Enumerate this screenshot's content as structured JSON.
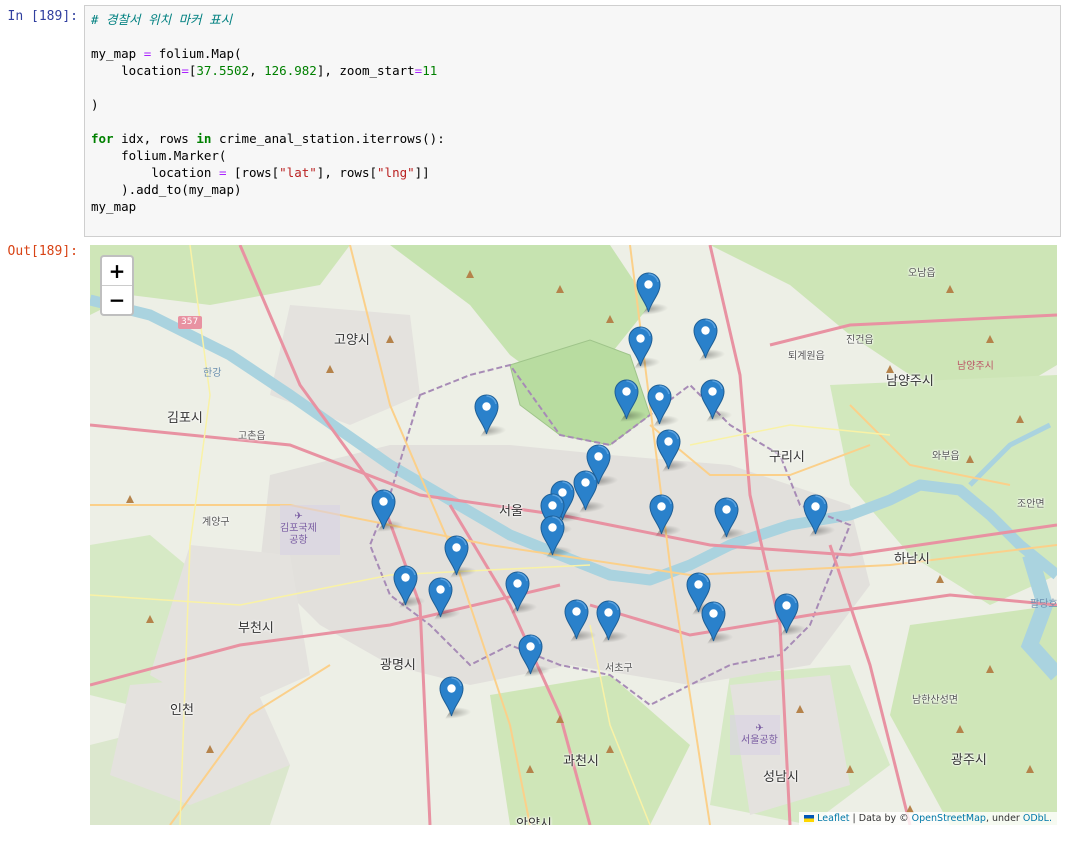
{
  "cell": {
    "in_prompt": "In [189]:",
    "out_prompt": "Out[189]:",
    "code_lines": [
      "# 경찰서 위치 마커 표시",
      "",
      "my_map = folium.Map(",
      "    location=[37.5502, 126.982], zoom_start=11",
      "",
      ")",
      "",
      "for idx, rows in crime_anal_station.iterrows():",
      "    folium.Marker(",
      "        location = [rows[\"lat\"], rows[\"lng\"]]",
      "    ).add_to(my_map)",
      "my_map"
    ]
  },
  "map": {
    "zoom_in": "+",
    "zoom_out": "−",
    "attribution": {
      "leaflet": "Leaflet",
      "sep": " | Data by © ",
      "osm": "OpenStreetMap",
      "under": ", under ",
      "odbl": "ODbL."
    },
    "labels": {
      "goyang": "고양시",
      "gimpo": "김포시",
      "bucheon": "부천시",
      "gwangmyeong": "광명시",
      "incheon": "인천",
      "seoul": "서울",
      "guri": "구리시",
      "hanam": "하남시",
      "namyangju": "남양주시",
      "gwacheon": "과천시",
      "seongnam": "성남시",
      "gwangju": "광주시",
      "anyang": "안양시",
      "seocho": "서초구",
      "gochon": "고촌읍",
      "gyeyang": "계양구",
      "toegyewon": "퇴계원읍",
      "jingeon": "진건읍",
      "onam": "오남읍",
      "waburi": "와부읍",
      "joan": "조안면",
      "namhansanseong": "남한산성면",
      "hangang": "한강",
      "airport_gimpo": "김포국제\n공항",
      "airport_seoul": "서울공항",
      "namyangju_small": "남양주시",
      "paldang": "팔당호",
      "route357": "357"
    },
    "markers_count": 31
  }
}
